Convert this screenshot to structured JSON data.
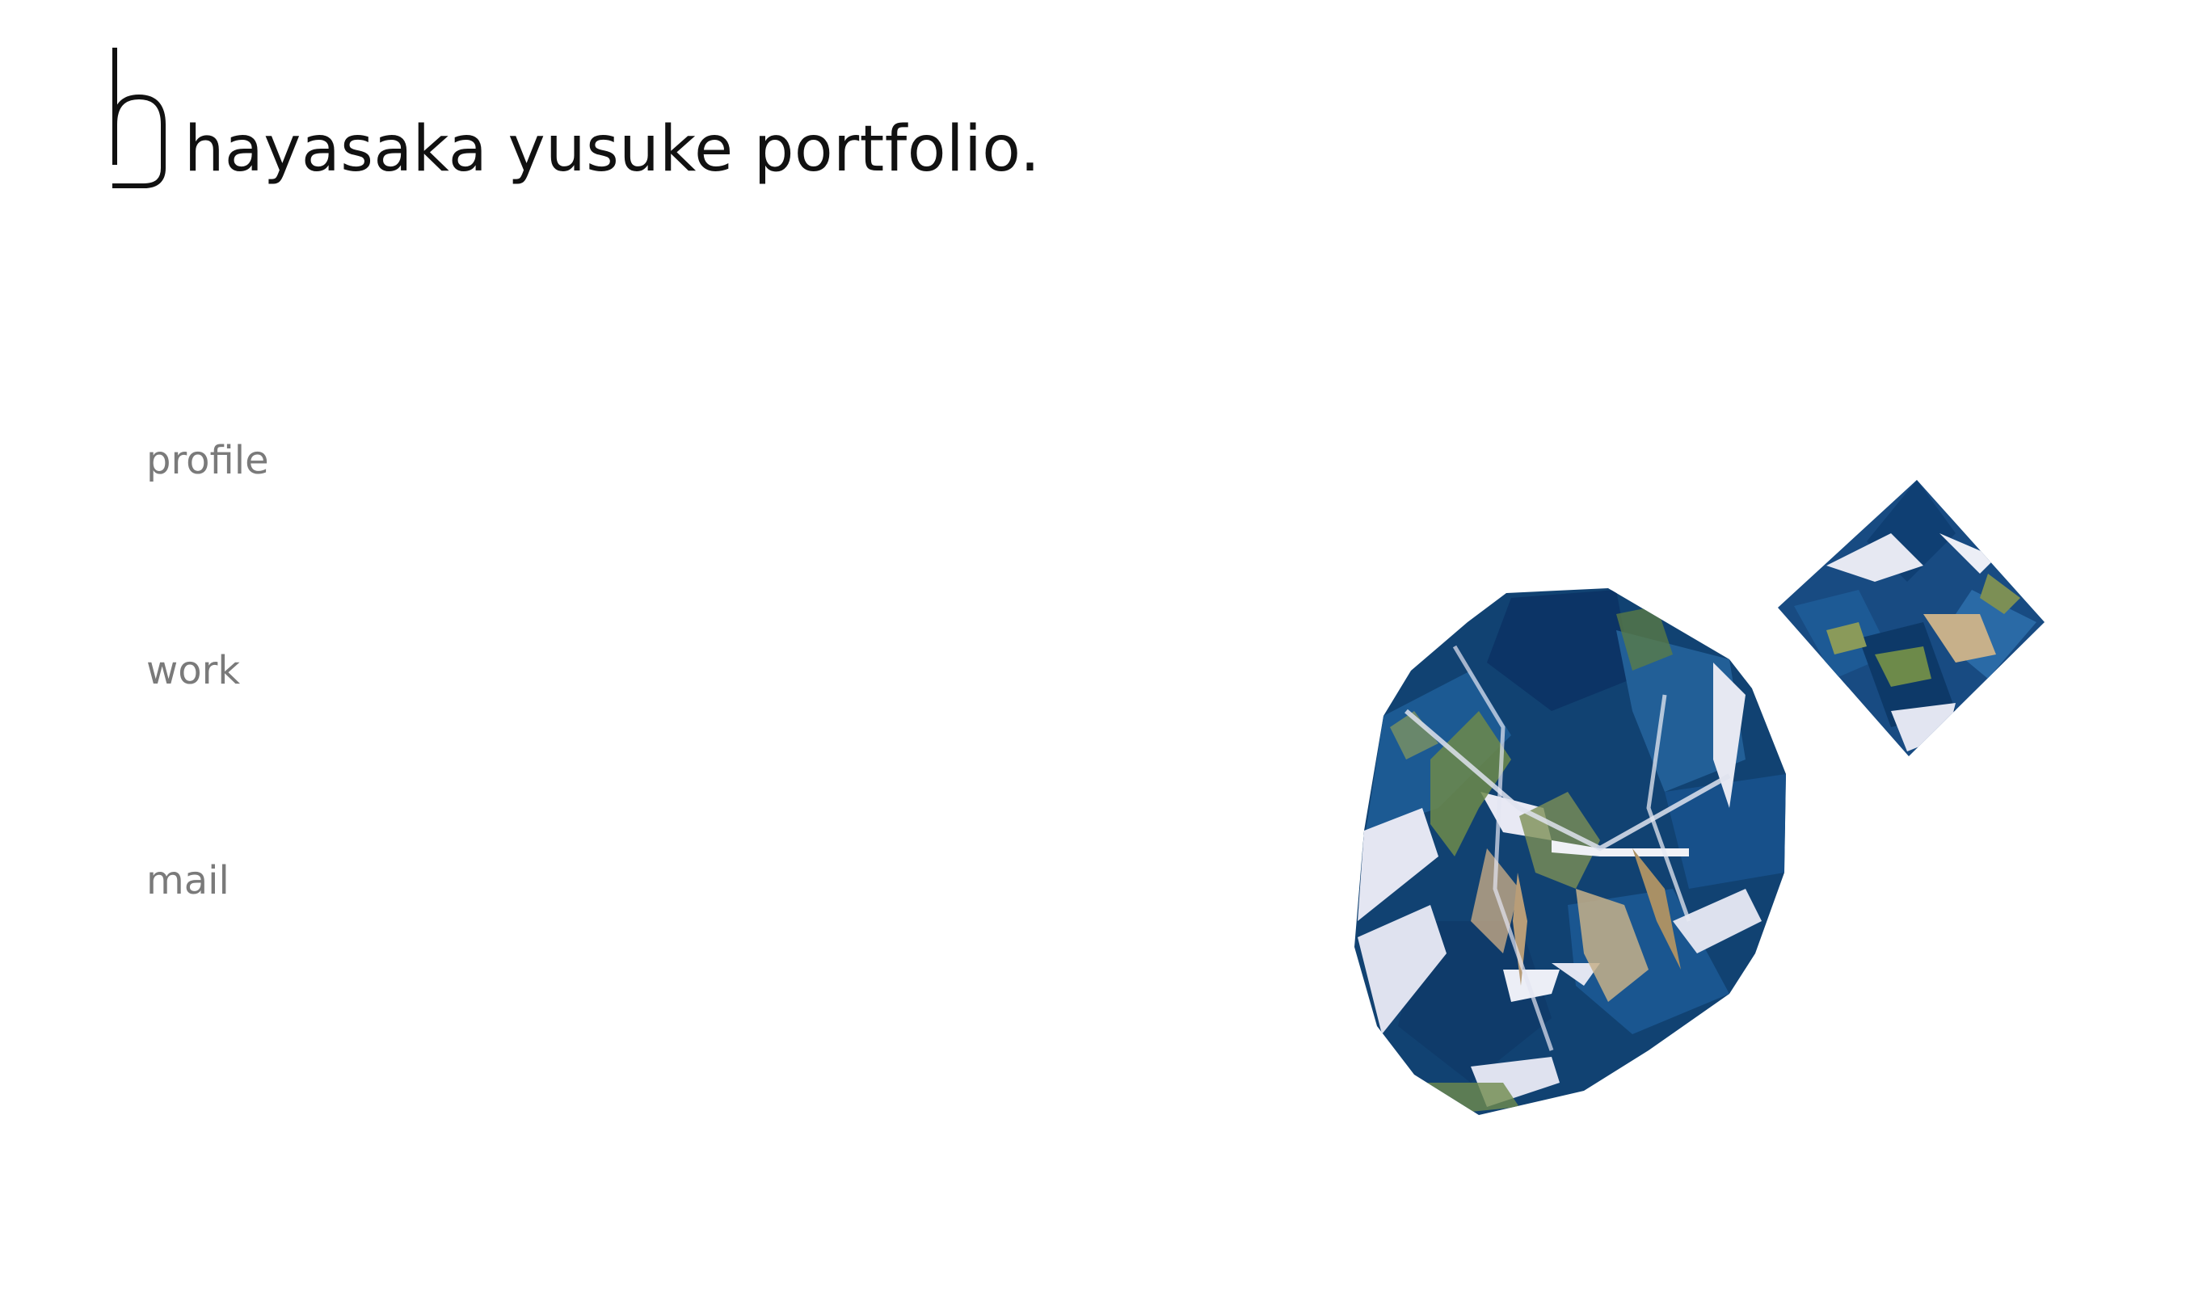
{
  "site": {
    "logo_icon": "hy-monogram-icon",
    "title": "hayasaka yusuke portfolio."
  },
  "nav": {
    "items": [
      {
        "label": "profile"
      },
      {
        "label": "work"
      },
      {
        "label": "mail"
      }
    ]
  },
  "scene": {
    "objects": [
      "large-earth-polyhedron",
      "small-earth-cube"
    ],
    "colors": {
      "ocean": "#0f3f73",
      "ocean_light": "#2d6aa3",
      "ice": "#e4e6f2",
      "land": "#6d8a4a",
      "desert": "#c7b08a"
    }
  }
}
